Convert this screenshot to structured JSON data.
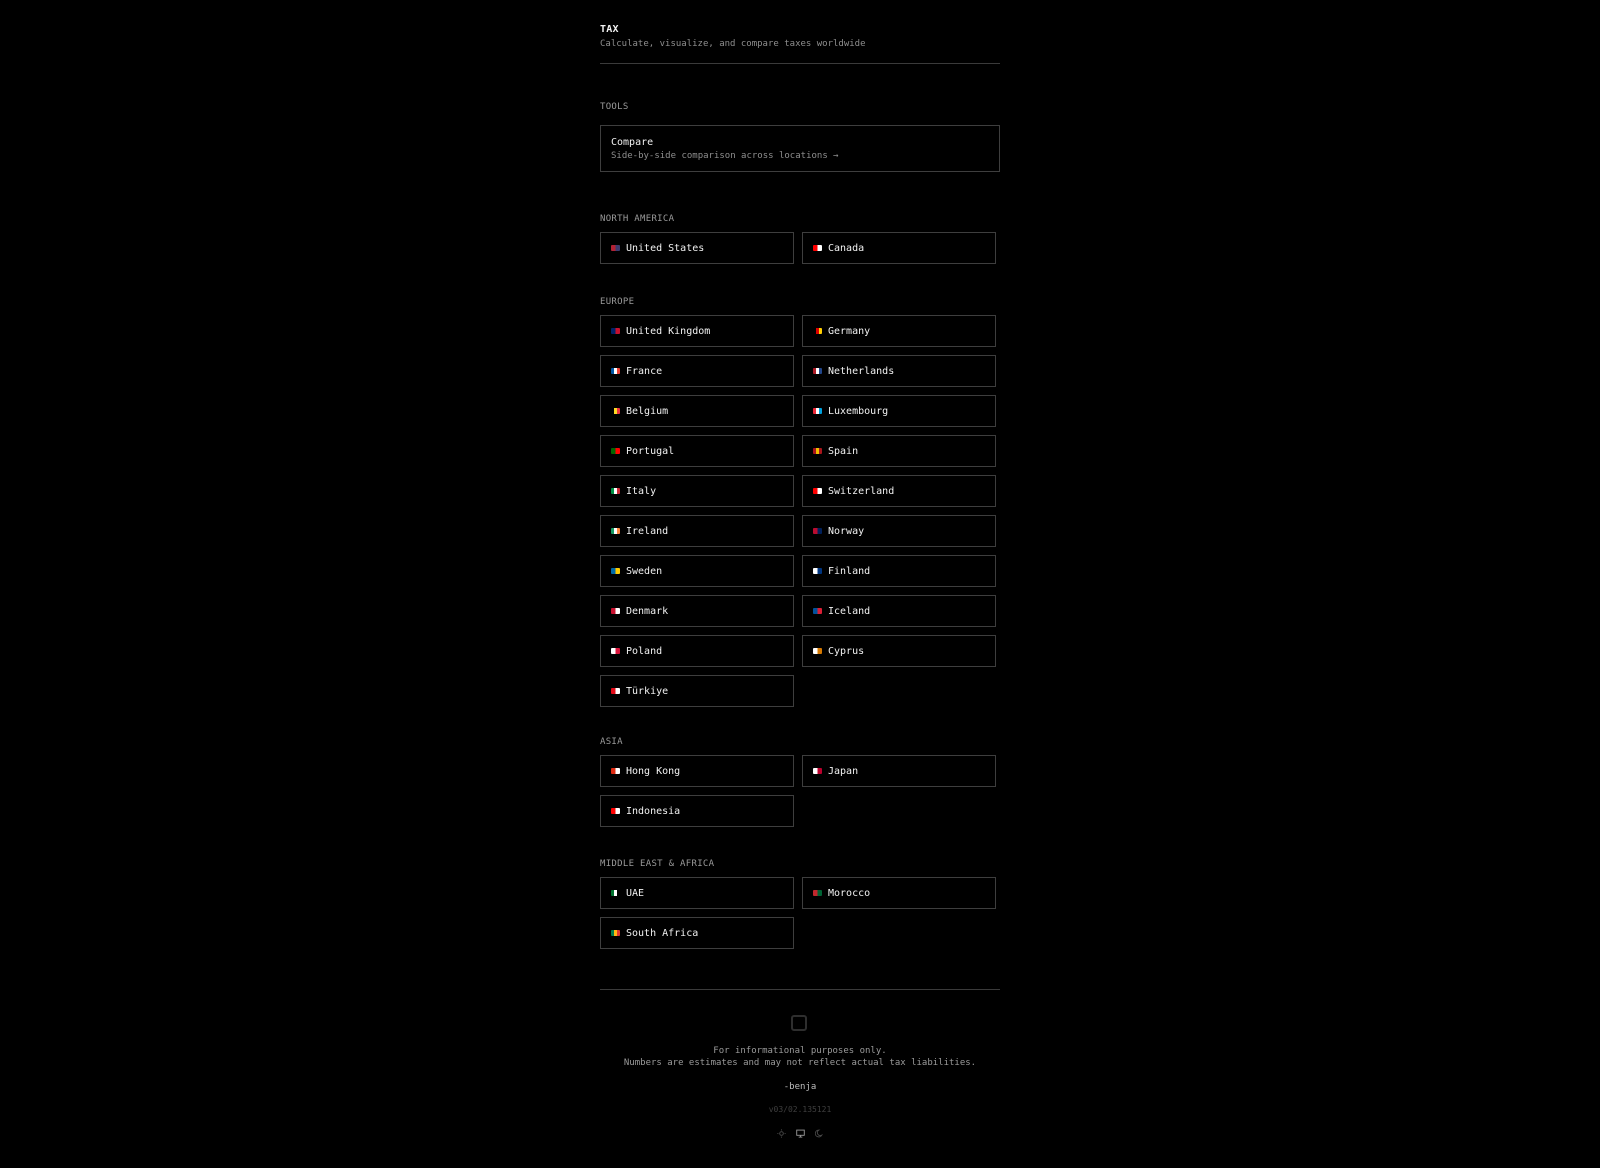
{
  "header": {
    "title": "TAX",
    "subtitle": "Calculate, visualize, and compare taxes worldwide"
  },
  "tools": {
    "label": "TOOLS",
    "compare": {
      "title": "Compare",
      "description": "Side-by-side comparison across locations →"
    }
  },
  "regions": [
    {
      "label": "NORTH AMERICA",
      "countries": [
        {
          "name": "United States",
          "flag_colors": [
            "#b22234",
            "#3c3b6e"
          ]
        },
        {
          "name": "Canada",
          "flag_colors": [
            "#ff0000",
            "#ffffff"
          ]
        }
      ]
    },
    {
      "label": "EUROPE",
      "countries": [
        {
          "name": "United Kingdom",
          "flag_colors": [
            "#012169",
            "#c8102e"
          ]
        },
        {
          "name": "Germany",
          "flag_colors": [
            "#000000",
            "#dd0000",
            "#ffce00"
          ]
        },
        {
          "name": "France",
          "flag_colors": [
            "#0055a4",
            "#ffffff",
            "#ef4135"
          ]
        },
        {
          "name": "Netherlands",
          "flag_colors": [
            "#ae1c28",
            "#ffffff",
            "#21468b"
          ]
        },
        {
          "name": "Belgium",
          "flag_colors": [
            "#000000",
            "#fdda24",
            "#ef3340"
          ]
        },
        {
          "name": "Luxembourg",
          "flag_colors": [
            "#ed2939",
            "#ffffff",
            "#00a1de"
          ]
        },
        {
          "name": "Portugal",
          "flag_colors": [
            "#006600",
            "#ff0000"
          ]
        },
        {
          "name": "Spain",
          "flag_colors": [
            "#aa151b",
            "#f1bf00",
            "#aa151b"
          ]
        },
        {
          "name": "Italy",
          "flag_colors": [
            "#009246",
            "#ffffff",
            "#ce2b37"
          ]
        },
        {
          "name": "Switzerland",
          "flag_colors": [
            "#ff0000",
            "#ffffff"
          ]
        },
        {
          "name": "Ireland",
          "flag_colors": [
            "#169b62",
            "#ffffff",
            "#ff883e"
          ]
        },
        {
          "name": "Norway",
          "flag_colors": [
            "#ba0c2f",
            "#00205b"
          ]
        },
        {
          "name": "Sweden",
          "flag_colors": [
            "#006aa7",
            "#fecc00"
          ]
        },
        {
          "name": "Finland",
          "flag_colors": [
            "#ffffff",
            "#003580"
          ]
        },
        {
          "name": "Denmark",
          "flag_colors": [
            "#c8102e",
            "#ffffff"
          ]
        },
        {
          "name": "Iceland",
          "flag_colors": [
            "#02529c",
            "#dc1e35"
          ]
        },
        {
          "name": "Poland",
          "flag_colors": [
            "#ffffff",
            "#dc143c"
          ]
        },
        {
          "name": "Cyprus",
          "flag_colors": [
            "#ffffff",
            "#d57800"
          ]
        },
        {
          "name": "Türkiye",
          "flag_colors": [
            "#e30a17",
            "#ffffff"
          ]
        }
      ]
    },
    {
      "label": "ASIA",
      "countries": [
        {
          "name": "Hong Kong",
          "flag_colors": [
            "#de2910",
            "#ffffff"
          ]
        },
        {
          "name": "Japan",
          "flag_colors": [
            "#ffffff",
            "#bc002d"
          ]
        },
        {
          "name": "Indonesia",
          "flag_colors": [
            "#ff0000",
            "#ffffff"
          ]
        }
      ]
    },
    {
      "label": "MIDDLE EAST & AFRICA",
      "countries": [
        {
          "name": "UAE",
          "flag_colors": [
            "#00732f",
            "#ffffff",
            "#000000"
          ]
        },
        {
          "name": "Morocco",
          "flag_colors": [
            "#c1272d",
            "#006233"
          ]
        },
        {
          "name": "South Africa",
          "flag_colors": [
            "#007a4d",
            "#ffb612",
            "#de3831"
          ]
        }
      ]
    }
  ],
  "footer": {
    "logo_icon": "square-logo-icon",
    "disclaimer_line1": "For informational purposes only.",
    "disclaimer_line2": "Numbers are estimates and may not reflect actual tax liabilities.",
    "signature": "-benja",
    "version": "v03/02.135121",
    "theme_options": [
      "sun-icon",
      "monitor-icon",
      "moon-icon"
    ]
  }
}
